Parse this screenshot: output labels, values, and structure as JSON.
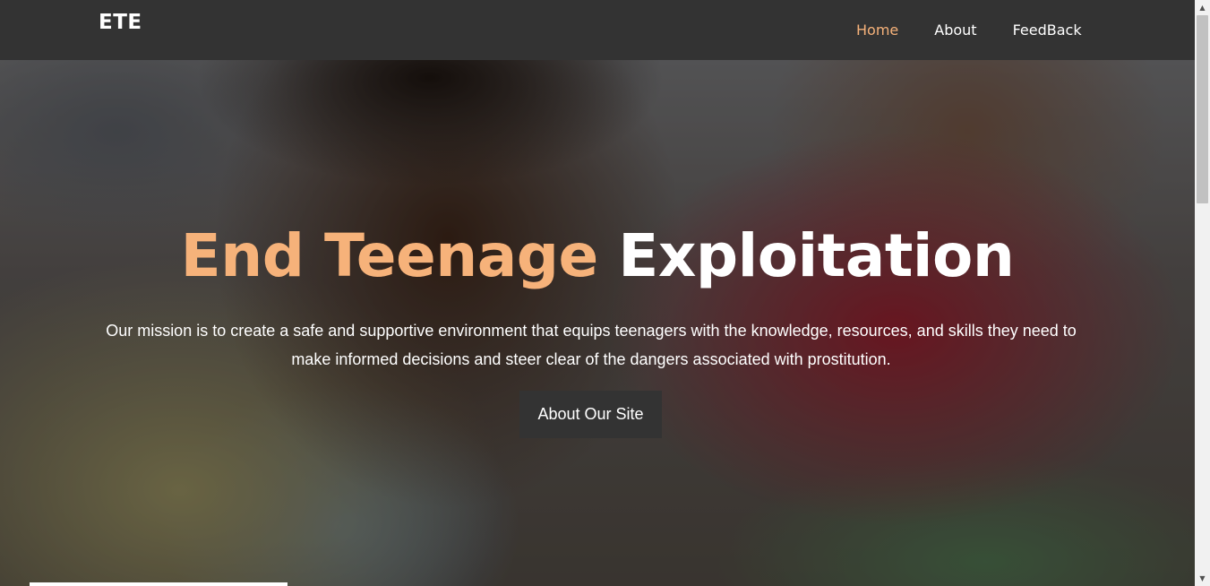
{
  "brand": "ETE",
  "nav": {
    "items": [
      {
        "label": "Home"
      },
      {
        "label": "About"
      },
      {
        "label": "FeedBack"
      }
    ],
    "active_color": "#f6b27a"
  },
  "hero": {
    "title_accent": "End Teenage",
    "title_main": "Exploitation",
    "description": "Our mission is to create a safe and supportive environment that equips teenagers with the knowledge, resources, and skills they need to make informed decisions and steer clear of the dangers associated with prostitution.",
    "button_label": "About Our Site"
  },
  "scrollbar": {
    "up_icon": "▲",
    "down_icon": "▼"
  }
}
